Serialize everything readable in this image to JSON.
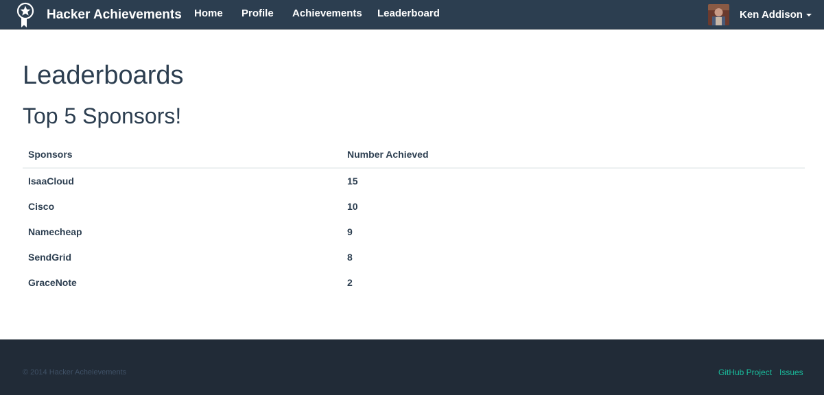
{
  "navbar": {
    "brand": "Hacker Achievements",
    "links": [
      {
        "label": "Home"
      },
      {
        "label": "Profile"
      },
      {
        "label": "Achievements"
      },
      {
        "label": "Leaderboard"
      }
    ],
    "user": {
      "name": "Ken Addison"
    }
  },
  "main": {
    "title": "Leaderboards",
    "section_title": "Top 5 Sponsors!",
    "table": {
      "headers": [
        "Sponsors",
        "Number Achieved"
      ],
      "rows": [
        [
          "IsaaCloud",
          "15"
        ],
        [
          "Cisco",
          "10"
        ],
        [
          "Namecheap",
          "9"
        ],
        [
          "SendGrid",
          "8"
        ],
        [
          "GraceNote",
          "2"
        ]
      ]
    }
  },
  "footer": {
    "copyright": "© 2014 Hacker Acheievements",
    "links": [
      {
        "label": "GitHub Project"
      },
      {
        "label": "Issues"
      }
    ]
  },
  "icons": {
    "brand": "award-ribbon-icon",
    "caret": "caret-down-icon"
  },
  "colors": {
    "navbar": "#2c3e50",
    "footer": "#212b37",
    "text": "#2c3e50",
    "accent": "#1abc9c"
  }
}
